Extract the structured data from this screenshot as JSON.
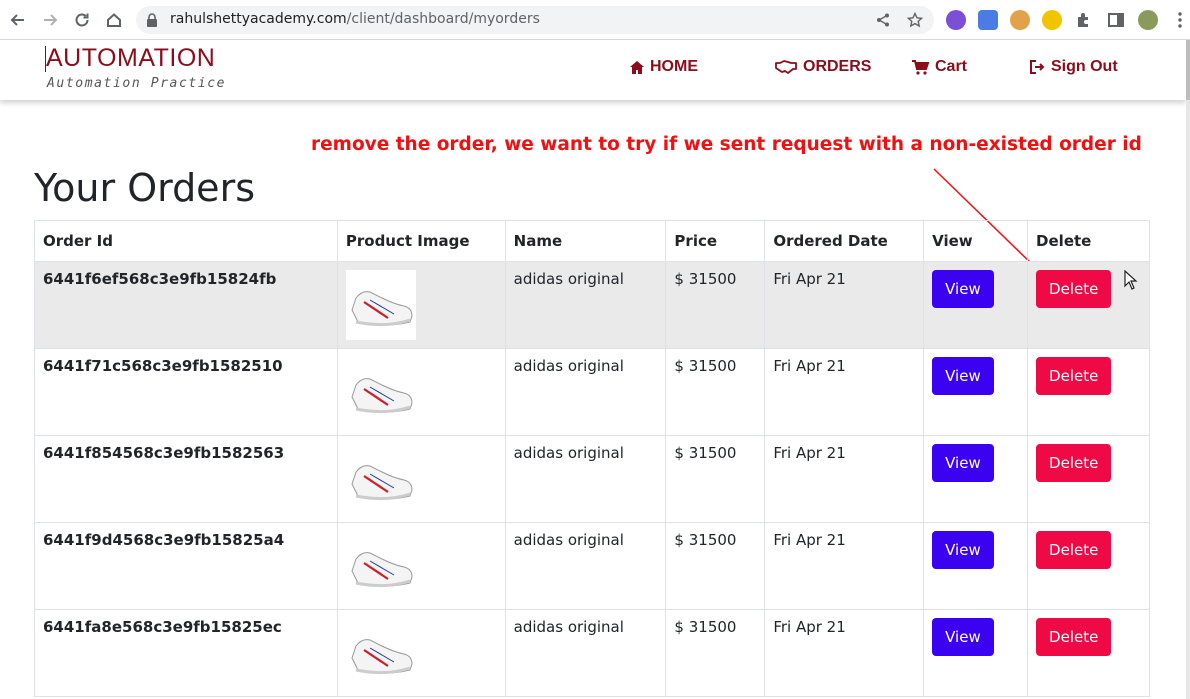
{
  "browser": {
    "url_domain": "rahulshettyacademy.com",
    "url_path": "/client/dashboard/myorders"
  },
  "header": {
    "brand": "AUTOMATION",
    "tagline": "Automation Practice",
    "nav": {
      "home": "HOME",
      "orders": "ORDERS",
      "cart": "Cart",
      "sign_out": "Sign Out"
    }
  },
  "annotation": "remove the order, we want to try if we sent request with a non-existed order id",
  "page_title": "Your Orders",
  "table": {
    "headers": [
      "Order Id",
      "Product Image",
      "Name",
      "Price",
      "Ordered Date",
      "View",
      "Delete"
    ],
    "rows": [
      {
        "order_id": "6441f6ef568c3e9fb15824fb",
        "name": "adidas original",
        "price": "$ 31500",
        "date": "Fri Apr 21",
        "view": "View",
        "delete": "Delete"
      },
      {
        "order_id": "6441f71c568c3e9fb1582510",
        "name": "adidas original",
        "price": "$ 31500",
        "date": "Fri Apr 21",
        "view": "View",
        "delete": "Delete"
      },
      {
        "order_id": "6441f854568c3e9fb1582563",
        "name": "adidas original",
        "price": "$ 31500",
        "date": "Fri Apr 21",
        "view": "View",
        "delete": "Delete"
      },
      {
        "order_id": "6441f9d4568c3e9fb15825a4",
        "name": "adidas original",
        "price": "$ 31500",
        "date": "Fri Apr 21",
        "view": "View",
        "delete": "Delete"
      },
      {
        "order_id": "6441fa8e568c3e9fb15825ec",
        "name": "adidas original",
        "price": "$ 31500",
        "date": "Fri Apr 21",
        "view": "View",
        "delete": "Delete"
      }
    ]
  },
  "colors": {
    "brand": "#8b0d1c",
    "view_button": "#3a02f0",
    "delete_button": "#ef0a45",
    "annotation": "#ee1111",
    "active_row": "#eaeaea"
  },
  "icons": {
    "home": "home-icon",
    "orders": "handshake-icon",
    "cart": "cart-icon",
    "sign_out": "sign-out-icon",
    "product": "sneaker-icon"
  }
}
